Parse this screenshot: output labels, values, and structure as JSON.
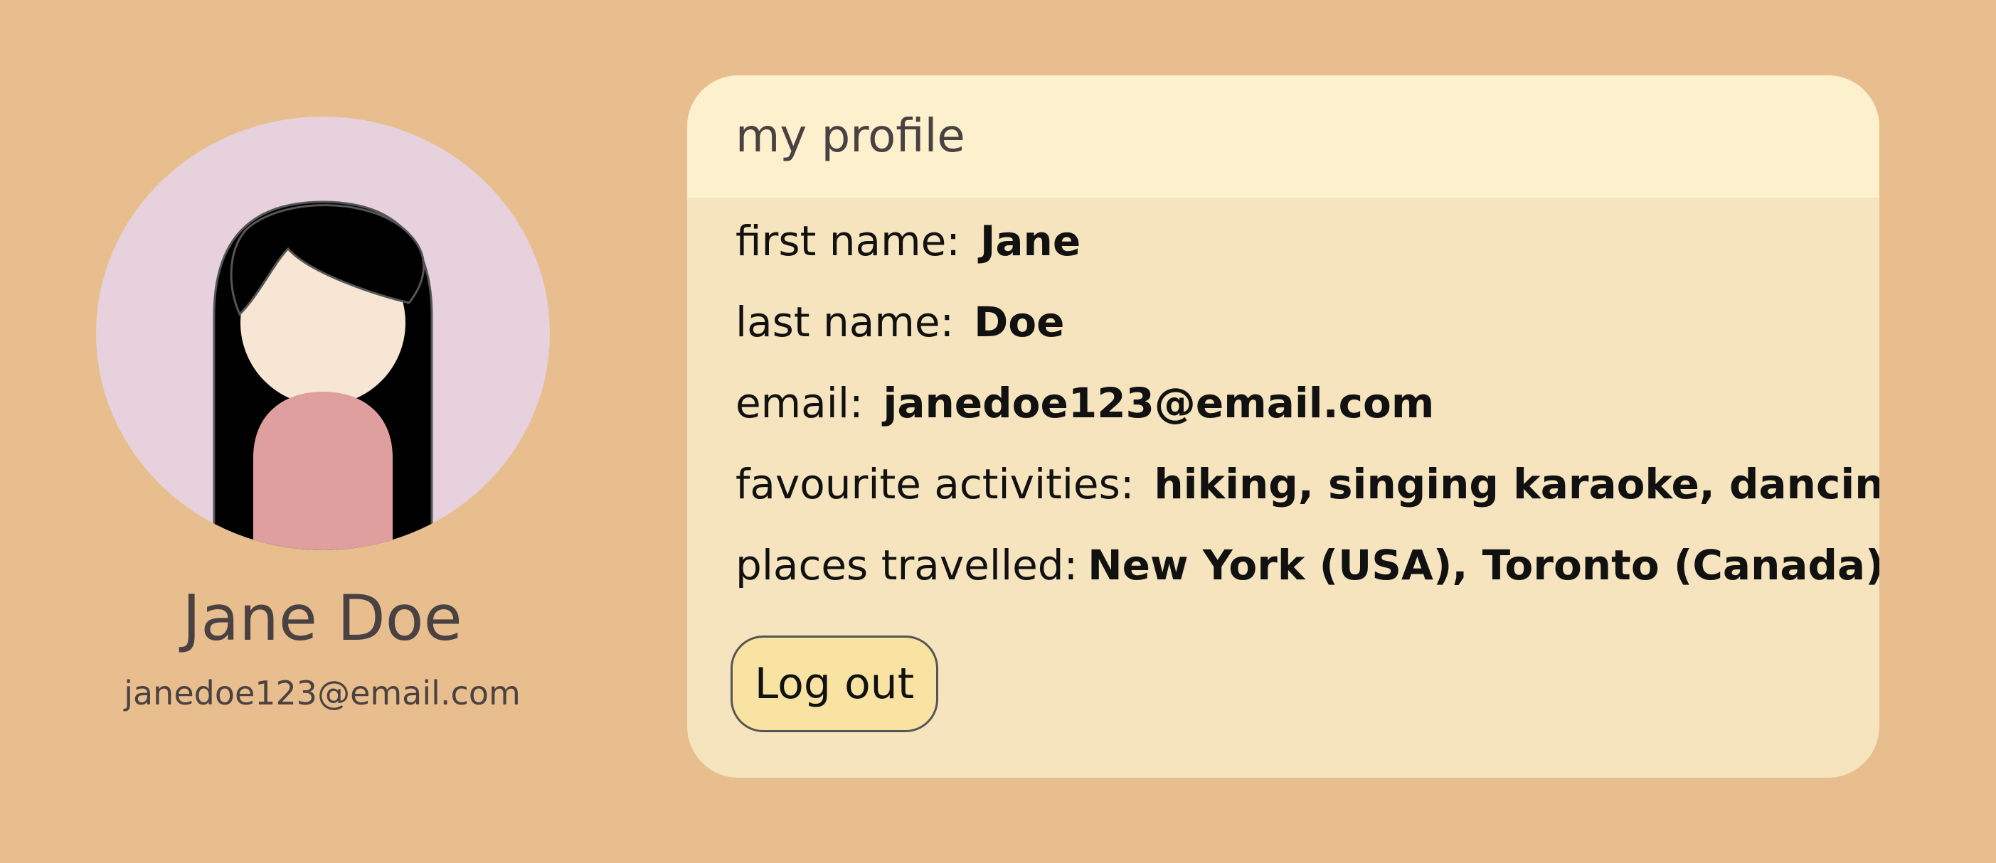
{
  "profile": {
    "name": "Jane Doe",
    "email": "janedoe123@email.com"
  },
  "avatar": {
    "icon": "user-avatar-illustration",
    "background_color": "#e6d1dc",
    "skin_color": "#f8e6d4",
    "hair_color": "#000000",
    "shirt_color": "#de9f9e"
  },
  "card": {
    "title": "my profile",
    "fields": [
      {
        "label": "first name:",
        "value": "Jane"
      },
      {
        "label": "last name:",
        "value": "Doe"
      },
      {
        "label": "email:",
        "value": "janedoe123@email.com"
      },
      {
        "label": "favourite activities:",
        "value": "hiking, singing karaoke, dancing"
      },
      {
        "label": "places travelled:",
        "value": "New York (USA), Toronto (Canada)"
      }
    ],
    "logout_label": "Log out"
  },
  "colors": {
    "page_background": "#e9be8e",
    "card_background": "#f5e4bd",
    "card_header_background": "#fdf0cc",
    "button_background": "#f9e3a3",
    "text": "#4a4242"
  }
}
